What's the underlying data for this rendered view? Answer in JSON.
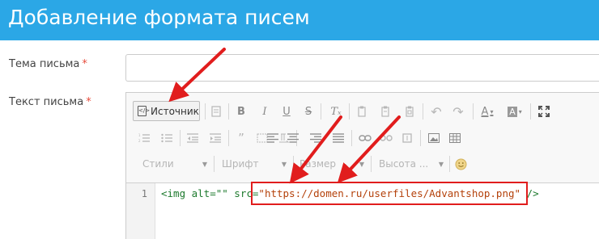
{
  "header": {
    "title": "Добавление формата писем"
  },
  "form": {
    "subject": {
      "label": "Тема письма",
      "required_mark": "*",
      "value": ""
    },
    "body": {
      "label": "Текст письма",
      "required_mark": "*"
    }
  },
  "toolbar": {
    "source_label": "Источник",
    "styles_label": "Стили",
    "font_label": "Шрифт",
    "size_label": "Размер",
    "height_label": "Высота ...",
    "bold": "B",
    "italic": "I",
    "underline": "U",
    "strike": "S",
    "remove_format": "Tₓ",
    "text_color": "A",
    "bg_color": "A"
  },
  "code": {
    "line_number": "1",
    "tag_open": "<img alt=\"\" src=",
    "src_value": "\"https://domen.ru/userfiles/Advantshop.png\"",
    "tag_close": " />"
  },
  "colors": {
    "header_bg": "#2ba7e6",
    "required": "#e74c3c",
    "annotation": "#e11d1d"
  }
}
